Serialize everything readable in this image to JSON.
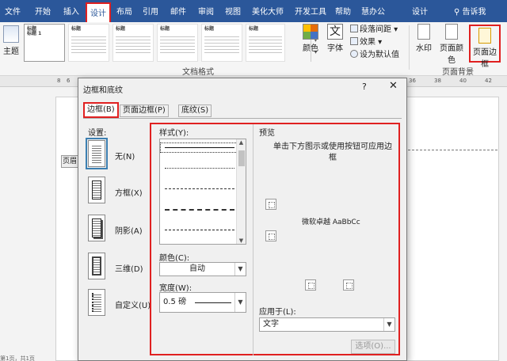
{
  "ribbon": {
    "tabs": [
      {
        "label": "文件"
      },
      {
        "label": "开始"
      },
      {
        "label": "插入"
      },
      {
        "label": "设计"
      },
      {
        "label": "布局"
      },
      {
        "label": "引用"
      },
      {
        "label": "邮件"
      },
      {
        "label": "审阅"
      },
      {
        "label": "视图"
      },
      {
        "label": "美化大师"
      },
      {
        "label": "开发工具"
      },
      {
        "label": "帮助"
      },
      {
        "label": "慧办公"
      },
      {
        "label": "设计"
      }
    ],
    "tell_me": "告诉我",
    "theme_label": "主题",
    "style_thumbs": [
      {
        "title": "标题"
      },
      {
        "title": "标题"
      },
      {
        "title": "标题"
      },
      {
        "title": "标题"
      },
      {
        "title": "标题"
      },
      {
        "title": "标题"
      }
    ],
    "thumb_heading": "标题 1",
    "colors_label": "颜色",
    "fonts_label": "字体",
    "fonts_glyph": "文",
    "paragraph_spacing": "段落间距",
    "effects": "效果",
    "set_default": "设为默认值",
    "group_document_format": "文档格式",
    "watermark": "水印",
    "page_color": "页面颜色",
    "page_borders": "页面边框",
    "group_page_background": "页面背景"
  },
  "ruler": {
    "ticks": [
      "8",
      "6",
      "4",
      "2",
      "2",
      "4",
      "6",
      "8",
      "36",
      "38",
      "40",
      "42"
    ]
  },
  "document": {
    "header_tag": "页眉",
    "status": "第1页，共1页"
  },
  "dialog": {
    "title": "边框和底纹",
    "help": "?",
    "close": "✕",
    "tabs": [
      "边框(B)",
      "页面边框(P)",
      "底纹(S)"
    ],
    "settings_label": "设置:",
    "settings": [
      "无(N)",
      "方框(X)",
      "阴影(A)",
      "三维(D)",
      "自定义(U)"
    ],
    "style_label": "样式(Y):",
    "color_label": "颜色(C):",
    "color_value": "自动",
    "width_label": "宽度(W):",
    "width_value": "0.5 磅",
    "preview_label": "预览",
    "preview_hint": "单击下方图示或使用按钮可应用边框",
    "sample_text": "微软卓越  AaBbCc",
    "apply_label": "应用于(L):",
    "apply_value": "文字",
    "options_button": "选项(O)..."
  },
  "colors": {
    "ribbon_blue": "#2b579a",
    "highlight_red": "#e02020"
  }
}
